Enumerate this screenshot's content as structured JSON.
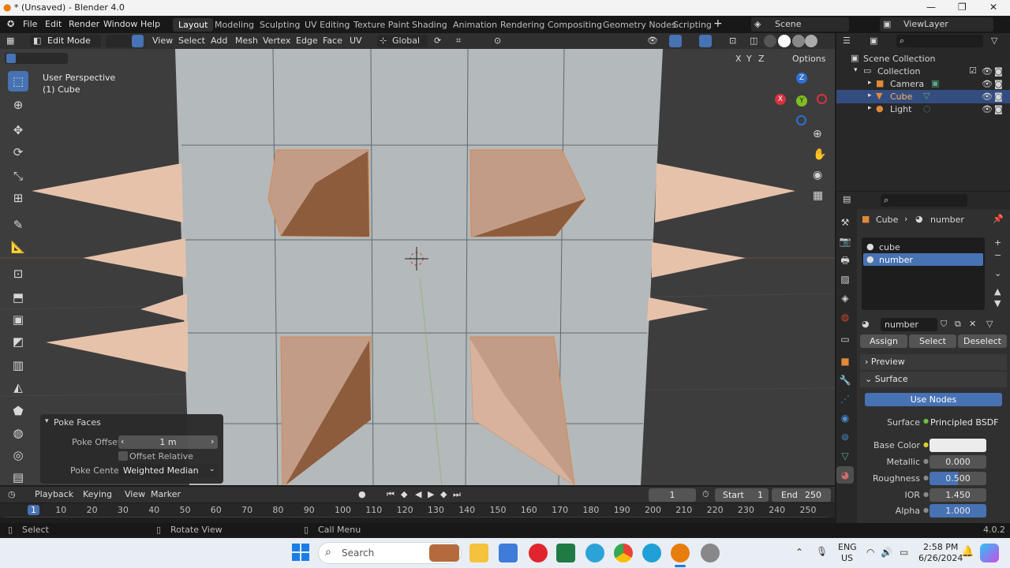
{
  "window": {
    "title": "* (Unsaved) - Blender 4.0"
  },
  "menus": [
    "File",
    "Edit",
    "Render",
    "Window",
    "Help"
  ],
  "workspaces": [
    "Layout",
    "Modeling",
    "Sculpting",
    "UV Editing",
    "Texture Paint",
    "Shading",
    "Animation",
    "Rendering",
    "Compositing",
    "Geometry Nodes",
    "Scripting"
  ],
  "scene": {
    "name": "Scene",
    "view_layer": "ViewLayer"
  },
  "viewport": {
    "mode": "Edit Mode",
    "menus": [
      "View",
      "Select",
      "Add",
      "Mesh",
      "Vertex",
      "Edge",
      "Face",
      "UV"
    ],
    "transform": "Global",
    "perspective": "User Perspective",
    "object": "(1) Cube",
    "options": "Options",
    "axes": [
      "X",
      "Y",
      "Z"
    ]
  },
  "operator": {
    "title": "Poke Faces",
    "offset_label": "Poke Offset",
    "offset_value": "1 m",
    "relative_label": "Offset Relative",
    "center_label": "Poke Center",
    "center_value": "Weighted Median"
  },
  "timeline": {
    "menus": [
      "Playback",
      "Keying",
      "View",
      "Marker"
    ],
    "current": "1",
    "start_label": "Start",
    "start": "1",
    "end_label": "End",
    "end": "250",
    "ticks": [
      "1",
      "10",
      "20",
      "30",
      "40",
      "50",
      "60",
      "70",
      "80",
      "90",
      "100",
      "110",
      "120",
      "130",
      "140",
      "150",
      "160",
      "170",
      "180",
      "190",
      "200",
      "210",
      "220",
      "230",
      "240",
      "250"
    ]
  },
  "status": {
    "select": "Select",
    "rotate": "Rotate View",
    "menu": "Call Menu",
    "version": "4.0.2"
  },
  "outliner": {
    "root": "Scene Collection",
    "collection": "Collection",
    "items": [
      "Camera",
      "Cube",
      "Light"
    ]
  },
  "properties": {
    "breadcrumb_obj": "Cube",
    "breadcrumb_mat": "number",
    "slots": [
      "cube",
      "number"
    ],
    "material_name": "number",
    "assign": "Assign",
    "select": "Select",
    "deselect": "Deselect",
    "preview": "Preview",
    "surface_panel": "Surface",
    "use_nodes": "Use Nodes",
    "surface_label": "Surface",
    "surface_value": "Principled BSDF",
    "base_color_label": "Base Color",
    "metallic_label": "Metallic",
    "metallic": "0.000",
    "roughness_label": "Roughness",
    "roughness": "0.500",
    "ior_label": "IOR",
    "ior": "1.450",
    "alpha_label": "Alpha",
    "alpha": "1.000"
  },
  "taskbar": {
    "search": "Search",
    "lang1": "ENG",
    "lang2": "US",
    "time": "2:58 PM",
    "date": "6/26/2024"
  },
  "colors": {
    "accent": "#4772b3",
    "face": "#c29c86",
    "grid": "#b4b9bb"
  }
}
